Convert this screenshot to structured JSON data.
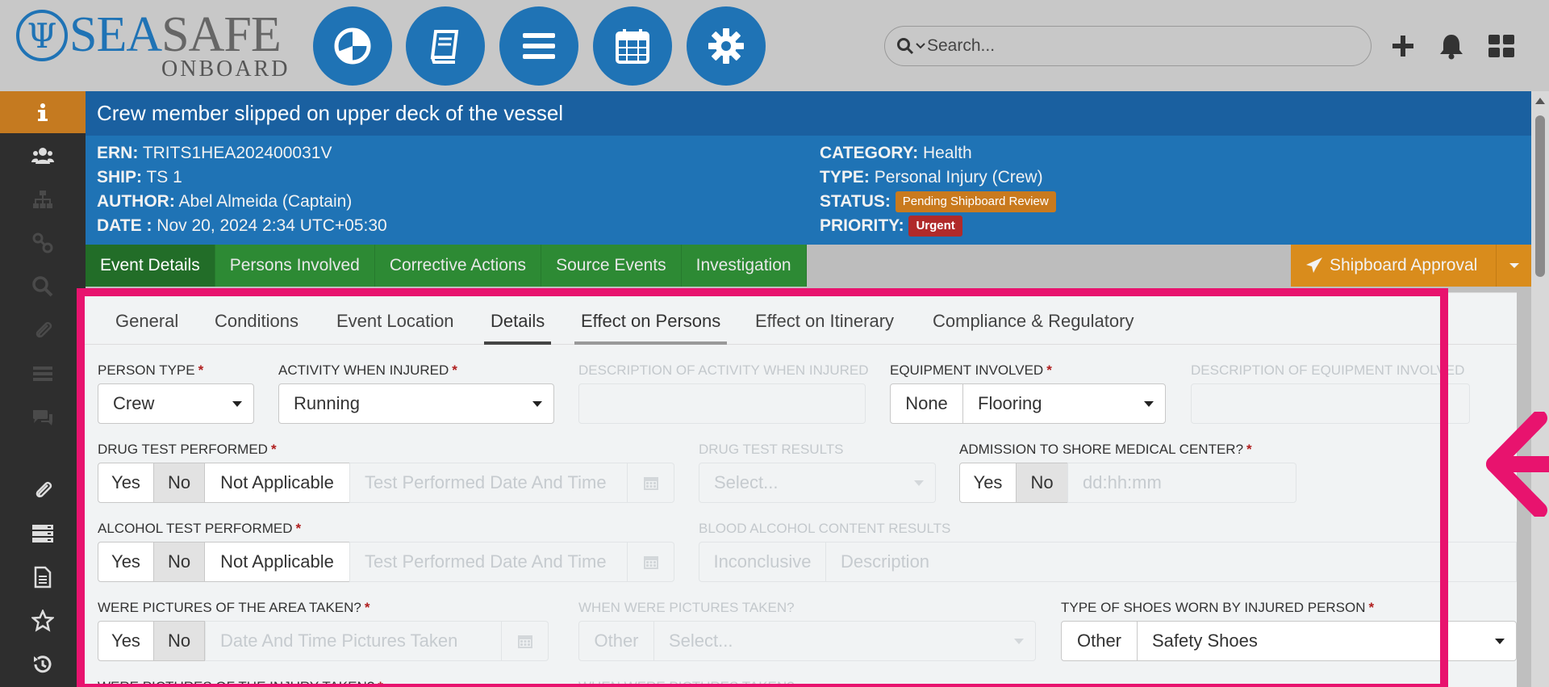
{
  "brand": {
    "sea": "SEA",
    "safe": "SAFE",
    "onboard": "ONBOARD",
    "mark": "Ψ"
  },
  "nav": [
    {
      "icon": "pie-chart-icon"
    },
    {
      "icon": "book-icon"
    },
    {
      "icon": "menu-icon"
    },
    {
      "icon": "calendar-icon"
    },
    {
      "icon": "gear-icon"
    }
  ],
  "search": {
    "placeholder": "Search..."
  },
  "sidebar": [
    "info-icon",
    "users-icon",
    "org-chart-icon",
    "link-icon",
    "search-icon",
    "attachment-icon",
    "list-icon",
    "comments-icon",
    "paperclip-icon",
    "stack-icon",
    "document-icon",
    "star-icon",
    "history-icon"
  ],
  "event": {
    "title": "Crew member slipped on upper deck of the vessel",
    "ern_label": "ERN:",
    "ern": "TRITS1HEA202400031V",
    "ship_label": "SHIP:",
    "ship": "TS 1",
    "author_label": "AUTHOR:",
    "author": "Abel Almeida (Captain)",
    "date_label": "DATE :",
    "date": "Nov 20, 2024 2:34 UTC+05:30",
    "category_label": "CATEGORY:",
    "category": "Health",
    "type_label": "TYPE:",
    "type": "Personal Injury (Crew)",
    "status_label": "STATUS:",
    "status": "Pending Shipboard Review",
    "priority_label": "PRIORITY:",
    "priority": "Urgent"
  },
  "tabs": [
    "Event Details",
    "Persons Involved",
    "Corrective Actions",
    "Source Events",
    "Investigation"
  ],
  "approval_label": "Shipboard Approval",
  "subtabs": [
    "General",
    "Conditions",
    "Event Location",
    "Details",
    "Effect on Persons",
    "Effect on Itinerary",
    "Compliance & Regulatory"
  ],
  "form": {
    "person_type": {
      "label": "PERSON TYPE",
      "value": "Crew"
    },
    "activity": {
      "label": "ACTIVITY WHEN INJURED",
      "value": "Running"
    },
    "activity_desc": {
      "label": "DESCRIPTION OF ACTIVITY WHEN INJURED"
    },
    "equipment": {
      "label": "EQUIPMENT INVOLVED",
      "none": "None",
      "value": "Flooring"
    },
    "equipment_desc": {
      "label": "DESCRIPTION OF EQUIPMENT INVOLVED"
    },
    "drug_test": {
      "label": "DRUG TEST PERFORMED",
      "yes": "Yes",
      "no": "No",
      "na": "Not Applicable",
      "placeholder": "Test Performed Date And Time"
    },
    "drug_results": {
      "label": "DRUG TEST RESULTS",
      "placeholder": "Select..."
    },
    "admission": {
      "label": "ADMISSION TO SHORE MEDICAL CENTER?",
      "yes": "Yes",
      "no": "No",
      "placeholder": "dd:hh:mm"
    },
    "alcohol_test": {
      "label": "ALCOHOL TEST PERFORMED",
      "yes": "Yes",
      "no": "No",
      "na": "Not Applicable",
      "placeholder": "Test Performed Date And Time"
    },
    "bac": {
      "label": "BLOOD ALCOHOL CONTENT RESULTS",
      "inconclusive": "Inconclusive",
      "placeholder": "Description"
    },
    "pictures_area": {
      "label": "WERE PICTURES OF THE AREA TAKEN?",
      "yes": "Yes",
      "no": "No",
      "placeholder": "Date And Time Pictures Taken"
    },
    "when_pictures": {
      "label": "WHEN WERE PICTURES TAKEN?",
      "other": "Other",
      "placeholder": "Select..."
    },
    "shoes": {
      "label": "TYPE OF SHOES WORN BY INJURED PERSON",
      "other": "Other",
      "value": "Safety Shoes"
    },
    "pictures_injury": {
      "label": "WERE PICTURES OF THE INJURY TAKEN?"
    },
    "when_pictures_2": {
      "label": "WHEN WERE PICTURES TAKEN?"
    }
  },
  "colors": {
    "brand_blue": "#1f73b5",
    "tab_green": "#2d8a34",
    "approval_orange": "#d98c1c",
    "urgent_red": "#b02a2a",
    "highlight": "#e8136e"
  }
}
